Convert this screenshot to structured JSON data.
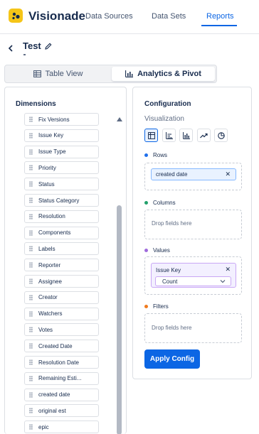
{
  "app": {
    "name": "Visionade"
  },
  "nav": {
    "items": [
      "Data Sources",
      "Data Sets",
      "Reports"
    ],
    "active": "Reports"
  },
  "report": {
    "title": "Test"
  },
  "view_toggle": {
    "table_label": "Table View",
    "analytics_label": "Analytics & Pivot",
    "active": "Analytics & Pivot"
  },
  "dimensions": {
    "title": "Dimensions",
    "fields": [
      "Fix Versions",
      "Issue Key",
      "Issue Type",
      "Priority",
      "Status",
      "Status Category",
      "Resolution",
      "Components",
      "Labels",
      "Reporter",
      "Assignee",
      "Creator",
      "Watchers",
      "Votes",
      "Created Date",
      "Resolution Date",
      "Remaining Esti...",
      "created date",
      "original est",
      "epic"
    ]
  },
  "config": {
    "title": "Configuration",
    "visualization_label": "Visualization",
    "viz_icons": [
      "table-icon",
      "bar-chart-icon",
      "column-chart-icon",
      "line-chart-icon",
      "pie-chart-icon"
    ],
    "active_viz": "table-icon",
    "rows": {
      "label": "Rows",
      "color": "#1f6feb",
      "chips": [
        "created date"
      ]
    },
    "columns": {
      "label": "Columns",
      "color": "#22a06b",
      "placeholder": "Drop fields here"
    },
    "values": {
      "label": "Values",
      "color": "#9f6bdc",
      "field": "Issue Key",
      "aggregation": "Count"
    },
    "filters": {
      "label": "Filters",
      "color": "#f07b1e",
      "placeholder": "Drop fields here"
    },
    "apply_label": "Apply Config"
  }
}
